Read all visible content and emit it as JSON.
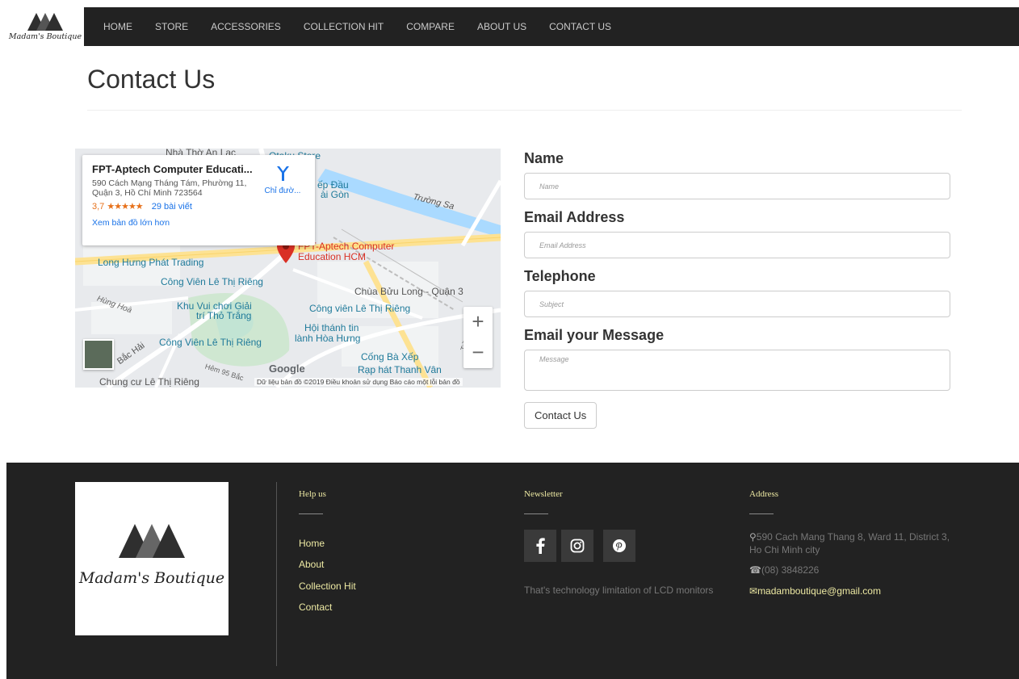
{
  "brand": {
    "name": "Madam's Boutique"
  },
  "nav": {
    "items": [
      {
        "label": "HOME"
      },
      {
        "label": "STORE"
      },
      {
        "label": "ACCESSORIES"
      },
      {
        "label": "COLLECTION HIT"
      },
      {
        "label": "COMPARE"
      },
      {
        "label": "ABOUT US"
      },
      {
        "label": "CONTACT US"
      }
    ]
  },
  "page": {
    "title": "Contact Us"
  },
  "map": {
    "card": {
      "title": "FPT-Aptech Computer Educati...",
      "address": "590 Cách Mạng Tháng Tám, Phường 11, Quận 3, Hồ Chí Minh 723564",
      "rating": "3,7",
      "stars": "★★★★★",
      "reviews": "29 bài viết",
      "directions": "Chỉ đườ...",
      "larger_map": "Xem bản đồ lớn hơn"
    },
    "labels": {
      "nha_tho": "Nhà Thờ An Lạc",
      "otaku": "Otaku Store",
      "tiep_dau": "ếp Đầu",
      "sai_gon": "ài Gòn",
      "truong_sa": "Trường Sa",
      "fpt1": "FPT-Aptech Computer",
      "fpt2": "Education HCM",
      "long_hung": "Long Hưng Phát Trading",
      "cong_vien1": "Công Viên Lê Thị Riêng",
      "chua": "Chùa Bửu Long - Quận 3",
      "hung_hoa": "Hùng Hoà",
      "khu_vui1": "Khu Vui chơi Giải",
      "khu_vui2": "trí Thỏ Trắng",
      "cong_vien2": "Công viên Lê Thị Riêng",
      "hoi_thanh1": "Hội thánh tin",
      "hoi_thanh2": "lành Hòa Hưng",
      "cong_vien3": "Công Viên Lê Thị Riêng",
      "bac_hai": "Bắc Hải",
      "cong_ba": "Cống Bà Xếp",
      "rap_hat": "Rạp hát Thanh Vân",
      "chung_cu": "Chung cư Lê Thị Riêng",
      "hem": "Hẻm 95 Bắc",
      "tran_van": "Trần Văn",
      "google": "Google"
    },
    "zoom_in": "+",
    "zoom_out": "−",
    "footer": "Dữ liệu bản đồ ©2019   Điều khoản sử dụng   Báo cáo một lỗi bản đồ"
  },
  "form": {
    "name_label": "Name",
    "name_placeholder": "Name",
    "email_label": "Email Address",
    "email_placeholder": "Email Address",
    "phone_label": "Telephone",
    "phone_placeholder": "Subject",
    "message_label": "Email your Message",
    "message_placeholder": "Message",
    "submit_label": "Contact Us"
  },
  "footer": {
    "logo_text": "Madam's Boutique",
    "help": {
      "heading": "Help us",
      "links": [
        {
          "label": "Home"
        },
        {
          "label": "About"
        },
        {
          "label": "Collection Hit"
        },
        {
          "label": "Contact"
        }
      ]
    },
    "newsletter": {
      "heading": "Newsletter",
      "social": [
        "facebook-icon",
        "instagram-icon",
        "pinterest-icon"
      ],
      "text": "That's technology limitation of LCD monitors"
    },
    "address": {
      "heading": "Address",
      "street": "590 Cach Mang Thang 8, Ward 11, District 3, Ho Chi Minh city",
      "phone": "(08) 3848226",
      "email": "madamboutique@gmail.com"
    }
  },
  "colors": {
    "navbar": "#222222",
    "footer": "#222222",
    "footer_accent": "#ede9a3",
    "map_pin": "#d93025"
  }
}
